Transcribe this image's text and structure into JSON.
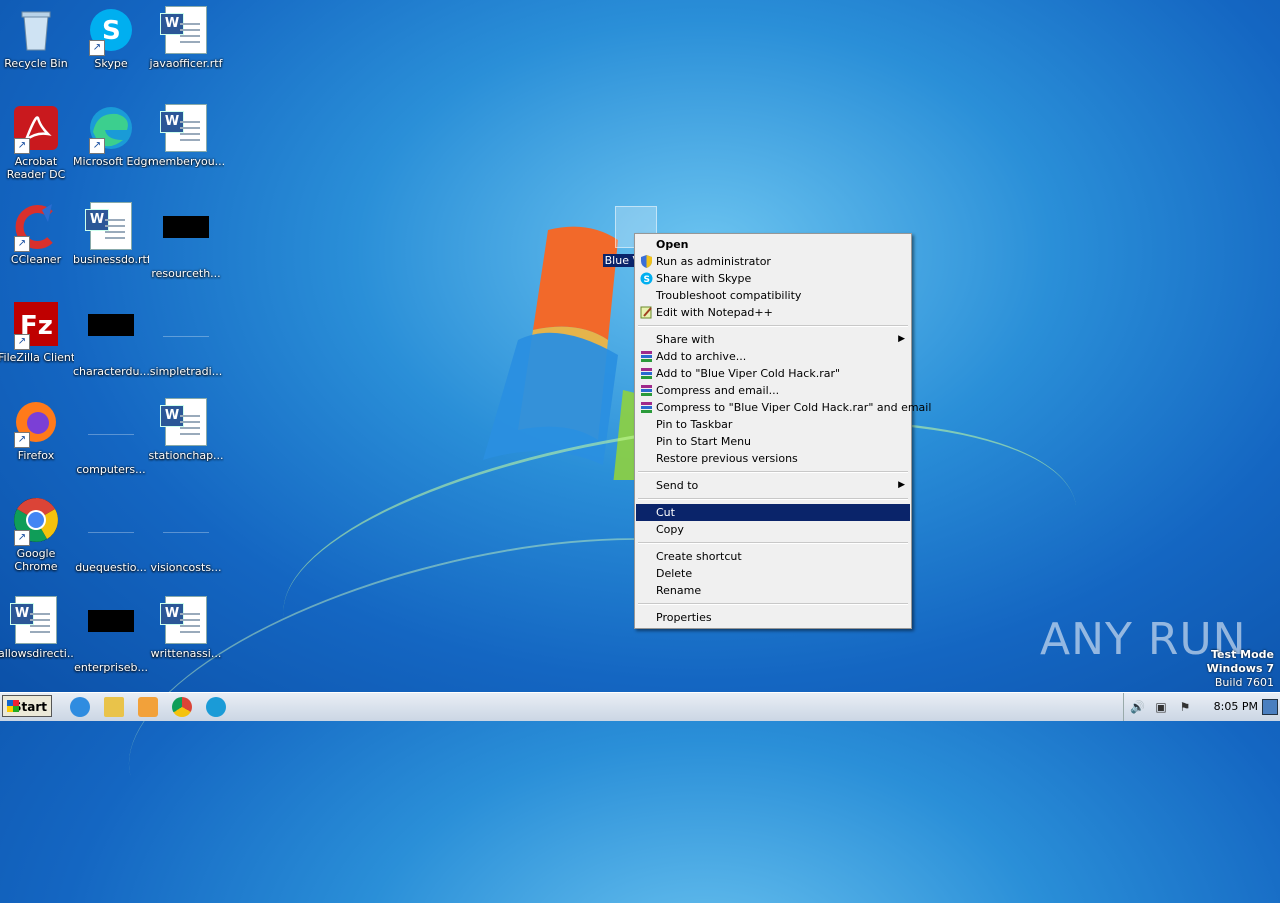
{
  "desktop": {
    "icons": [
      {
        "label": "Recycle Bin"
      },
      {
        "label": "Skype"
      },
      {
        "label": "javaofficer.rtf"
      },
      {
        "label": "Acrobat Reader DC"
      },
      {
        "label": "Microsoft Edge"
      },
      {
        "label": "memberyou..."
      },
      {
        "label": "CCleaner"
      },
      {
        "label": "businessdo.rtf"
      },
      {
        "label": "resourceth..."
      },
      {
        "label": "FileZilla Client"
      },
      {
        "label": "characterdu..."
      },
      {
        "label": "simpletradi..."
      },
      {
        "label": "Firefox"
      },
      {
        "label": "computers..."
      },
      {
        "label": "stationchap..."
      },
      {
        "label": "Google Chrome"
      },
      {
        "label": "duequestio..."
      },
      {
        "label": "visioncosts..."
      },
      {
        "label": "allowsdirecti..."
      },
      {
        "label": "enterpriseb..."
      },
      {
        "label": "writtenassi..."
      }
    ],
    "selected_icon_label": "Blue Vi Hac"
  },
  "context_menu": {
    "items": [
      {
        "label": "Open"
      },
      {
        "label": "Run as administrator"
      },
      {
        "label": "Share with Skype"
      },
      {
        "label": "Troubleshoot compatibility"
      },
      {
        "label": "Edit with Notepad++"
      },
      {
        "label": "Share with"
      },
      {
        "label": "Add to archive..."
      },
      {
        "label": "Add to \"Blue Viper Cold Hack.rar\""
      },
      {
        "label": "Compress and email..."
      },
      {
        "label": "Compress to \"Blue Viper Cold Hack.rar\" and email"
      },
      {
        "label": "Pin to Taskbar"
      },
      {
        "label": "Pin to Start Menu"
      },
      {
        "label": "Restore previous versions"
      },
      {
        "label": "Send to"
      },
      {
        "label": "Cut"
      },
      {
        "label": "Copy"
      },
      {
        "label": "Create shortcut"
      },
      {
        "label": "Delete"
      },
      {
        "label": "Rename"
      },
      {
        "label": "Properties"
      }
    ]
  },
  "watermark": {
    "text": "ANY RUN"
  },
  "os_info": {
    "line1": "Test Mode",
    "line2": "Windows 7",
    "line3": "Build 7601"
  },
  "taskbar": {
    "start_label": "Start",
    "clock": "8:05 PM"
  },
  "colors": {
    "menu_highlight": "#0a246a",
    "menu_bg": "#f0f0f0"
  }
}
